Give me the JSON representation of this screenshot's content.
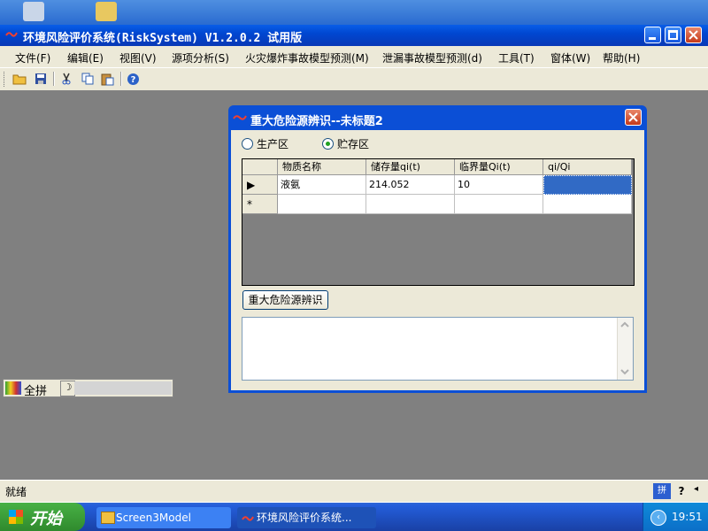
{
  "app": {
    "title": "环境风险评价系统(RiskSystem) V1.2.0.2 试用版"
  },
  "menu": {
    "items": [
      "文件(F)",
      "编辑(E)",
      "视图(V)",
      "源项分析(S)",
      "火灾爆炸事故模型预测(M)",
      "泄漏事故模型预测(d)",
      "工具(T)",
      "窗体(W)",
      "帮助(H)"
    ]
  },
  "toolbar": {
    "icons": [
      "open-folder-icon",
      "save-icon",
      "cut-icon",
      "copy-icon",
      "paste-icon",
      "help-icon"
    ]
  },
  "dialog": {
    "title": "重大危险源辨识--未标题2",
    "radios": [
      {
        "label": "生产区",
        "checked": false
      },
      {
        "label": "贮存区",
        "checked": true
      }
    ],
    "grid": {
      "headers": [
        "物质名称",
        "储存量qi(t)",
        "临界量Qi(t)",
        "qi/Qi"
      ],
      "rows": [
        {
          "marker": "▶",
          "cells": [
            "液氨",
            "214.052",
            "10",
            ""
          ]
        },
        {
          "marker": "*",
          "cells": [
            "",
            "",
            "",
            ""
          ]
        }
      ]
    },
    "identify_button": "重大危险源辨识",
    "output_text": ""
  },
  "ime": {
    "mode": "全拼"
  },
  "status": {
    "text": "就绪"
  },
  "taskbar": {
    "start_label": "开始",
    "tasks": [
      "Screen3Model",
      "环境风险评价系统..."
    ],
    "clock": "19:51"
  },
  "colors": {
    "title_blue": "#0047d1",
    "selected_cell": "#316ac5",
    "mdi_bg": "#808080"
  }
}
